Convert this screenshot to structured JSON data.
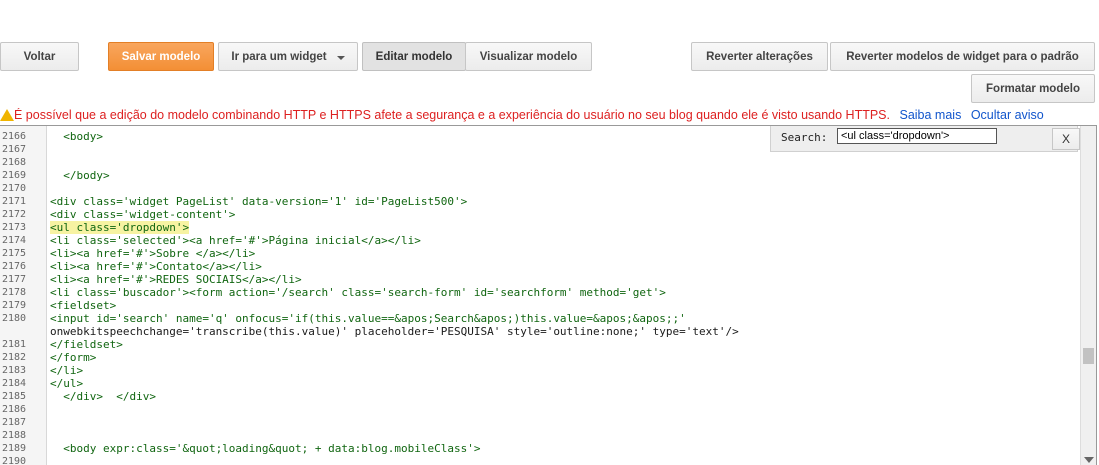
{
  "toolbar": {
    "back_label": "Voltar",
    "save_label": "Salvar modelo",
    "widget_jump_label": "Ir para um widget",
    "edit_label": "Editar modelo",
    "preview_label": "Visualizar modelo",
    "revert_label": "Reverter alterações",
    "revert_widgets_label": "Reverter modelos de widget para o padrão",
    "format_label": "Formatar modelo"
  },
  "warning": {
    "text": "É possível que a edição do modelo combinando HTTP e HTTPS afete a segurança e a experiência do usuário no seu blog quando ele é visto usando HTTPS.",
    "learn_more": "Saiba mais",
    "hide": "Ocultar aviso"
  },
  "search": {
    "label": "Search:",
    "value": "<ul class='dropdown'>",
    "close": "X"
  },
  "editor": {
    "line_numbers": [
      "2166",
      "2167",
      "2168",
      "2169",
      "2170",
      "2171",
      "2172",
      "2173",
      "2174",
      "2175",
      "2176",
      "2177",
      "2178",
      "2179",
      "2180",
      "",
      "2181",
      "2182",
      "2183",
      "2184",
      "2185",
      "2186",
      "2187",
      "2188",
      "2189",
      "2190"
    ],
    "lines": [
      "  <body>",
      "",
      "",
      "  </body>",
      "",
      "<div class='widget PageList' data-version='1' id='PageList500'>",
      "<div class='widget-content'>",
      "<ul class='dropdown'>",
      "<li class='selected'><a href='#'>Página inicial</a></li>",
      "<li><a href='#'>Sobre </a></li>",
      "<li><a href='#'>Contato</a></li>",
      "<li><a href='#'>REDES SOCIAIS</a></li>",
      "<li class='buscador'><form action='/search' class='search-form' id='searchform' method='get'>",
      "<fieldset>",
      "<input id='search' name='q' onfocus='if(this.value==&apos;Search&apos;)this.value=&apos;&apos;;'",
      "onwebkitspeechchange='transcribe(this.value)' placeholder='PESQUISA' style='outline:none;' type='text'/>",
      "</fieldset>",
      "</form>",
      "</li>",
      "</ul>",
      "  </div>  </div>",
      "",
      "",
      "",
      "  <body expr:class='&quot;loading&quot; + data:blog.mobileClass'>",
      ""
    ],
    "highlight_line_index": 7
  }
}
